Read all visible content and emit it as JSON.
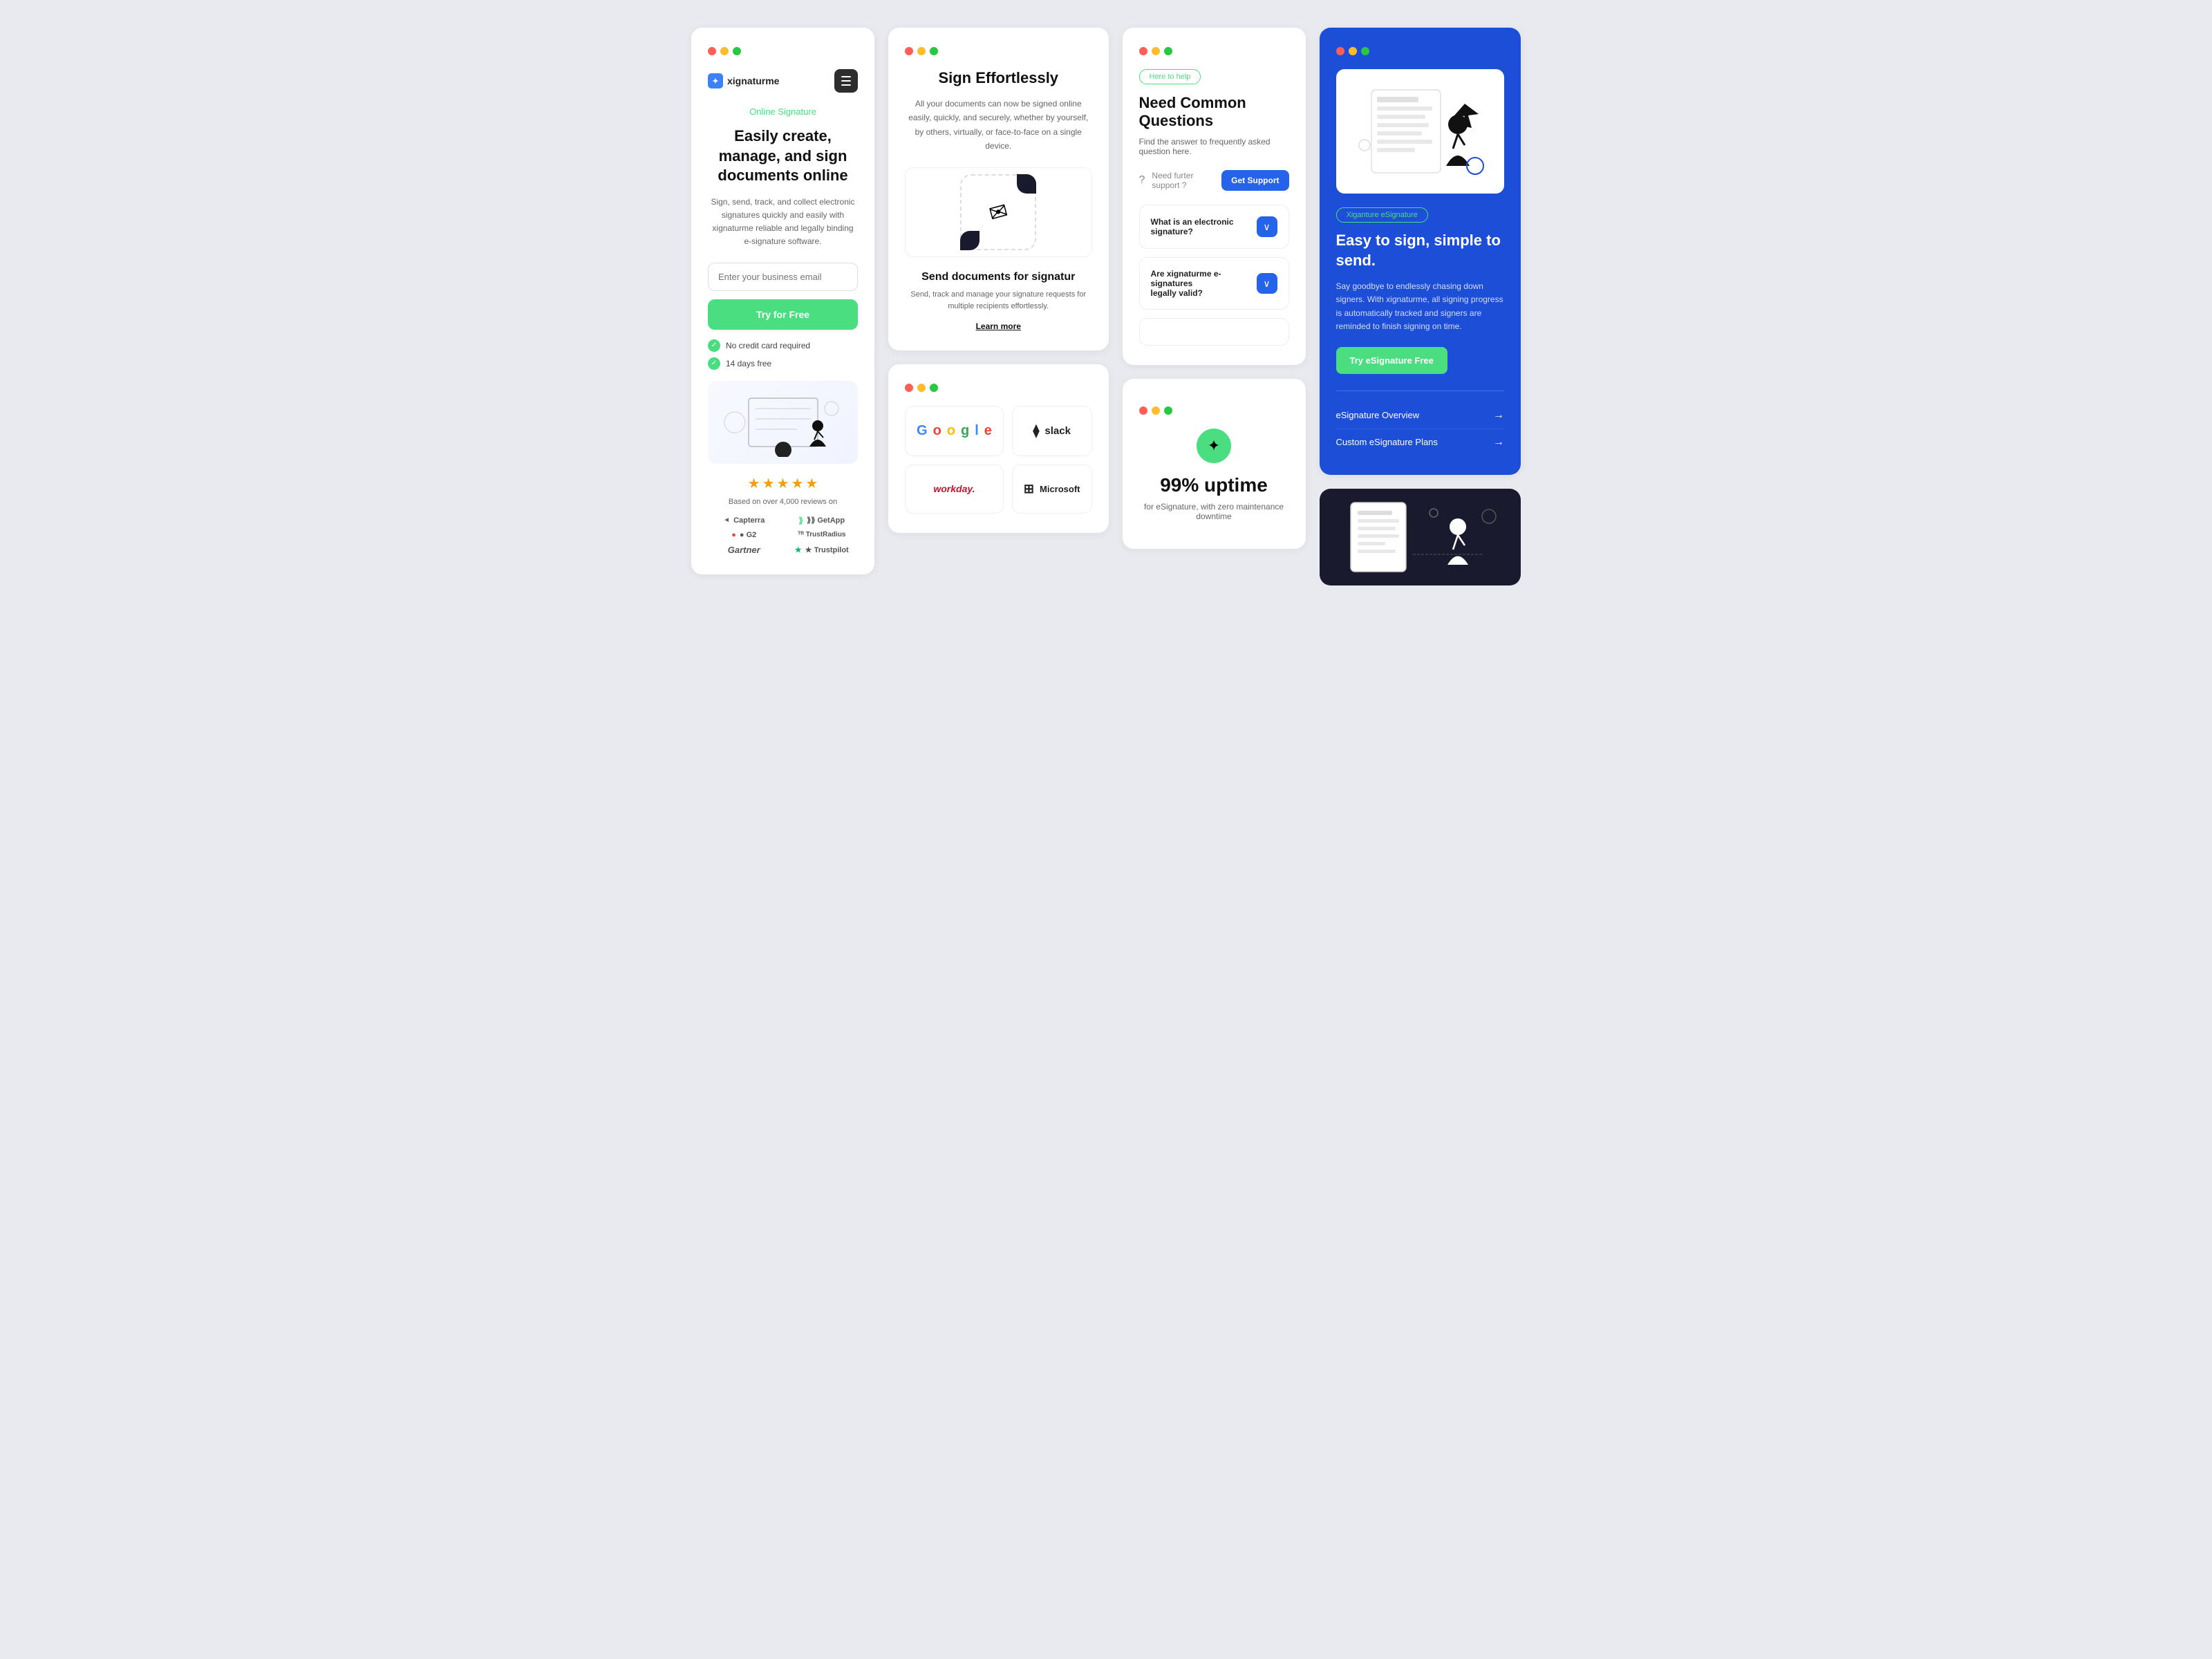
{
  "page": {
    "bg": "#e8eaf0"
  },
  "card1": {
    "badge": "Online Signature",
    "title": "Easily create, manage, and sign documents online",
    "desc": "Sign, send, track, and collect electronic signatures quickly and easily with xignaturme reliable and legally binding e-signature software.",
    "email_placeholder": "Enter your business email",
    "try_btn": "Try for Free",
    "check1": "No credit card required",
    "check2": "14 days free",
    "review_base": "Based on over 4,000 reviews on",
    "brand_name": "xignaturme",
    "stars": "★★★★★",
    "logos": [
      {
        "name": "Capterra",
        "prefix": "◄ "
      },
      {
        "name": "GetApp",
        "prefix": "⟫⟫ "
      },
      {
        "name": "G2",
        "prefix": ""
      },
      {
        "name": "TrustRadius",
        "prefix": "ᵀᴿ "
      },
      {
        "name": "Gartner",
        "prefix": ""
      },
      {
        "name": "Trustpilot",
        "prefix": "★ "
      }
    ]
  },
  "card2": {
    "title": "Sign Effortlessly",
    "desc": "All your documents can now be signed online easily, quickly, and securely, whether by yourself, by others, virtually, or face-to-face on a single device.",
    "send_title": "Send documents for signatur",
    "send_desc": "Send, track and manage your signature requests for multiple recipients effortlessly.",
    "learn_more": "Learn more"
  },
  "card3": {
    "integrations": [
      {
        "name": "Google",
        "icon": "G"
      },
      {
        "name": "slack",
        "icon": "⧫"
      },
      {
        "name": "workday.",
        "icon": ""
      },
      {
        "name": "Microsoft",
        "icon": "⊞"
      }
    ]
  },
  "card4": {
    "badge": "Here to help",
    "title": "Need Common Questions",
    "subtitle": "Find the answer to frequently asked question here.",
    "support_text": "Need furter support ?",
    "support_btn": "Get Support",
    "faqs": [
      {
        "q": "What is an electronic signature?"
      },
      {
        "q": "Are xignaturme e-signatures legally valid?"
      }
    ]
  },
  "card5": {
    "percent": "99% uptime",
    "desc": "for eSignature, with zero maintenance downtime"
  },
  "card6": {
    "badge": "Xiganture eSignature",
    "title": "Easy to sign, simple to send.",
    "desc": "Say goodbye to endlessly chasing down signers. With xignaturme, all signing progress is automatically tracked and signers are reminded to finish signing on time.",
    "try_btn": "Try eSignature Free",
    "link1": "eSignature Overview",
    "link2": "Custom eSignature Plans"
  }
}
